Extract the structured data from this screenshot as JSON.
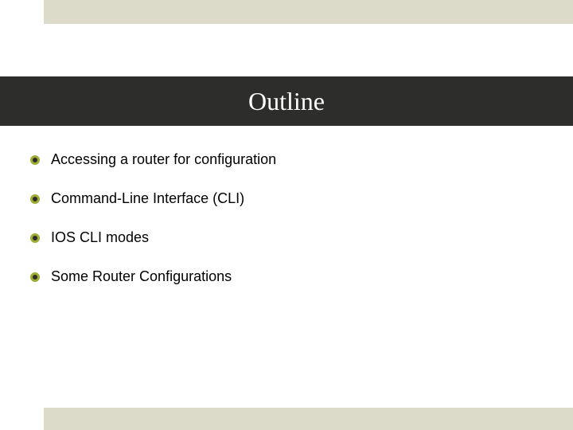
{
  "slide": {
    "title": "Outline",
    "bullets": [
      "Accessing a router for configuration",
      "Command-Line Interface (CLI)",
      "IOS CLI modes",
      "Some Router Configurations"
    ]
  }
}
